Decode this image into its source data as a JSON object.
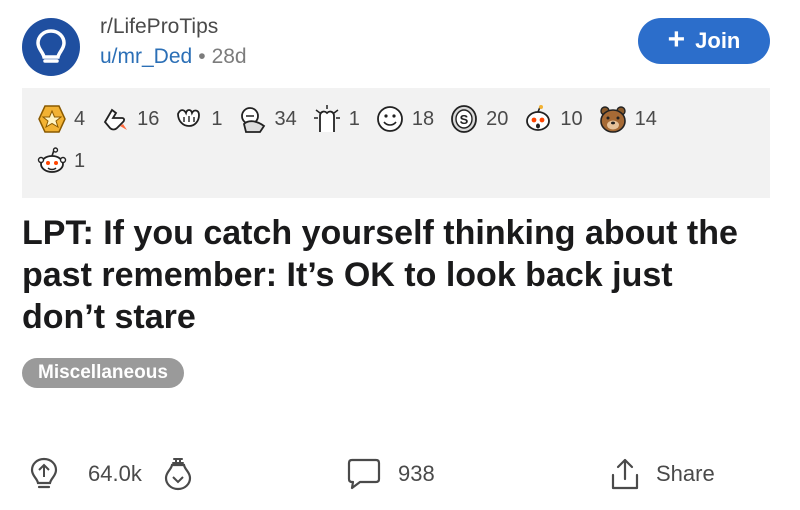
{
  "header": {
    "subreddit": "r/LifeProTips",
    "username": "u/mr_Ded",
    "separator": "•",
    "age": "28d",
    "join_plus": "+",
    "join_label": "Join",
    "accent_color": "#2c6ecb",
    "avatar_icon": "lightbulb-icon"
  },
  "awards": [
    {
      "icon": "star-medal-icon",
      "count": "4"
    },
    {
      "icon": "rocket-like-icon",
      "count": "16"
    },
    {
      "icon": "clapping-hands-icon",
      "count": "1"
    },
    {
      "icon": "wholesome-hug-icon",
      "count": "34"
    },
    {
      "icon": "bravo-icon",
      "count": "1"
    },
    {
      "icon": "face-icon",
      "count": "18"
    },
    {
      "icon": "silver-coin-icon",
      "count": "20"
    },
    {
      "icon": "snoo-surprised-icon",
      "count": "10"
    },
    {
      "icon": "bear-icon",
      "count": "14"
    },
    {
      "icon": "snoo-icon",
      "count": "1"
    }
  ],
  "post": {
    "title": "LPT: If you catch yourself thinking about the past remember: It’s OK to look back just don’t stare",
    "flair": "Miscellaneous"
  },
  "actions": {
    "upvotes": "64.0k",
    "comments": "938",
    "share_label": "Share"
  }
}
